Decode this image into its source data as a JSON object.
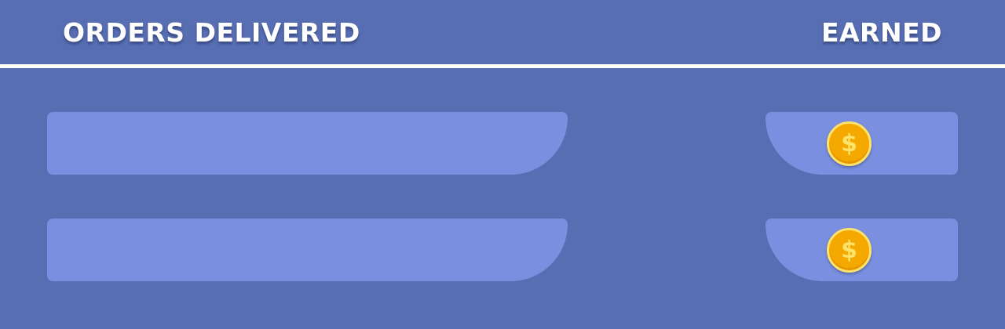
{
  "header": {
    "orders_label": "ORDERS DELIVERED",
    "earned_label": "EARNED"
  },
  "rows": [
    {
      "order_value": "",
      "earned_value": "",
      "coin_icon": "coin-icon",
      "coin_symbol": "$"
    },
    {
      "order_value": "",
      "earned_value": "",
      "coin_icon": "coin-icon",
      "coin_symbol": "$"
    }
  ],
  "colors": {
    "background": "#586eb3",
    "slot": "#7a8fdf",
    "divider": "#ffffff",
    "coin": "#f5a800",
    "coin_rim": "#fde36a"
  }
}
